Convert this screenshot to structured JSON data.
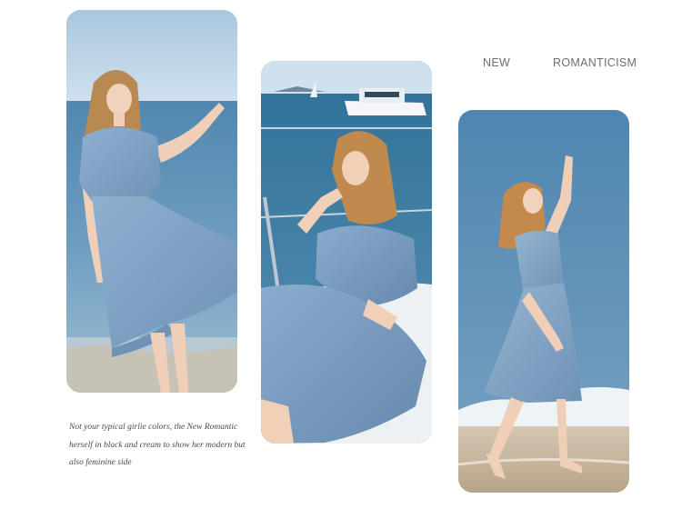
{
  "heading": {
    "word_1": "NEW",
    "word_2": "ROMANTICISM"
  },
  "caption": {
    "text": "Not your typical girlie colors, the New Romantic herself in black and cream to show her modern but also feminine side"
  },
  "photos": [
    {
      "name": "model-standing-beach-photo"
    },
    {
      "name": "model-seated-yacht-photo"
    },
    {
      "name": "model-walking-shoreline-photo"
    }
  ],
  "colors": {
    "dress": "#7fa0c2",
    "sea": "#5e8eb3",
    "sky": "#c9dbea",
    "sand": "#c9b59a",
    "text": "#6e6e6e"
  }
}
